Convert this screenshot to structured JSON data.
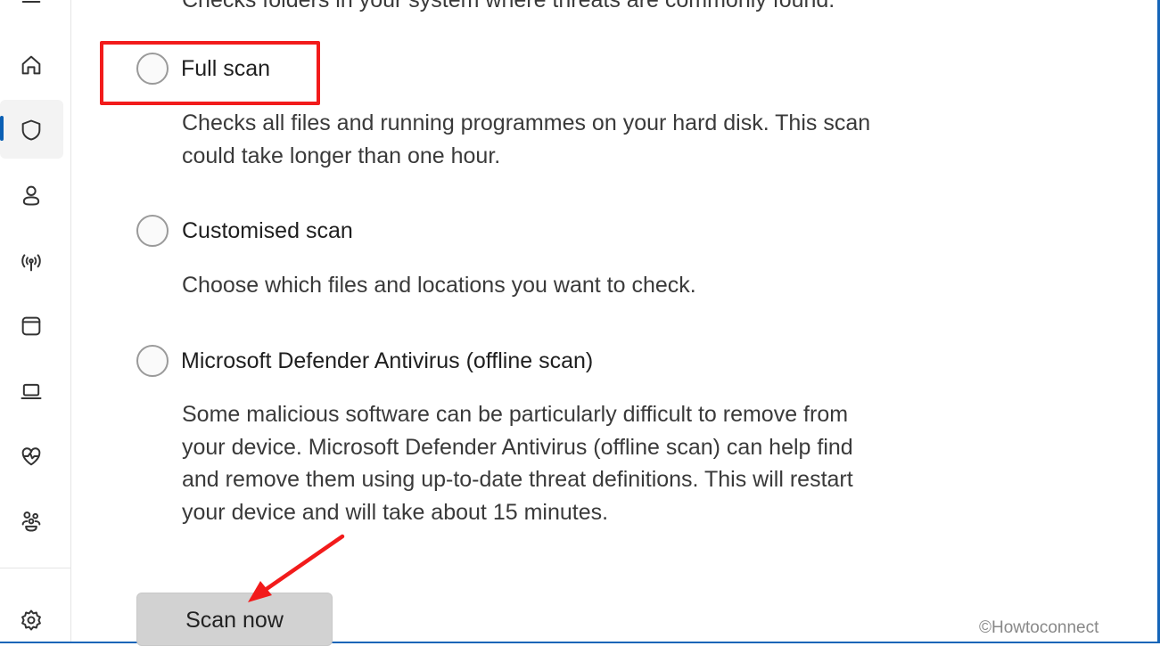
{
  "sidebar": {
    "items": [
      {
        "icon": "menu-icon"
      },
      {
        "icon": "home-icon"
      },
      {
        "icon": "shield-icon",
        "active": true
      },
      {
        "icon": "account-icon"
      },
      {
        "icon": "network-icon"
      },
      {
        "icon": "app-browser-icon"
      },
      {
        "icon": "laptop-icon"
      },
      {
        "icon": "health-icon"
      },
      {
        "icon": "family-icon"
      },
      {
        "icon": "settings-icon"
      }
    ],
    "accent": "#0a5fb4"
  },
  "main": {
    "top_partial_text": "Checks folders in your system where threats are commonly found.",
    "options": [
      {
        "label": "Full scan",
        "description": [
          "Checks all files and running programmes on your hard disk. This scan",
          "could take longer than one hour."
        ],
        "selected": false,
        "highlighted": true
      },
      {
        "label": "Customised scan",
        "description": [
          "Choose which files and locations you want to check."
        ],
        "selected": false
      },
      {
        "label": "Microsoft Defender Antivirus (offline scan)",
        "description": [
          "Some malicious software can be particularly difficult to remove from",
          "your device. Microsoft Defender Antivirus (offline scan) can help find",
          "and remove them using up-to-date threat definitions. This will restart",
          "your device and will take about 15 minutes."
        ],
        "selected": false
      }
    ],
    "scan_button": "Scan now"
  },
  "annotation_color": "#f21b1b",
  "watermark": "©Howtoconnect"
}
